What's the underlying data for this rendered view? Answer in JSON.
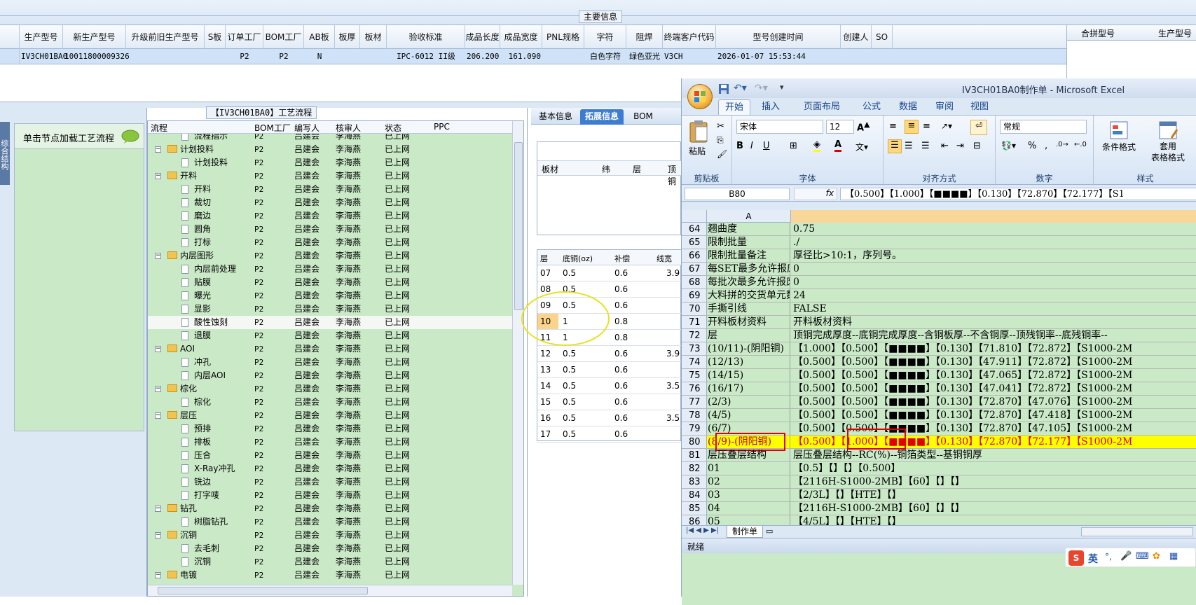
{
  "top": {
    "section_title": "主要信息"
  },
  "main_table": {
    "headers": [
      "生产型号",
      "新生产型号",
      "升级前旧生产型号",
      "S板",
      "订单工厂",
      "BOM工厂",
      "AB板",
      "板厚",
      "板材",
      "验收标准",
      "成品长度",
      "成品宽度",
      "PNL规格",
      "字符",
      "阻焊",
      "终端客户代码",
      "型号创建时间",
      "创建人",
      "SO"
    ],
    "row": [
      "IV3CH01BA0",
      "10011800009326",
      "",
      "",
      "P2",
      "P2",
      "N",
      "",
      "",
      "IPC-6012 II级",
      "206.200",
      "161.090",
      "",
      "白色字符",
      "绿色亚光",
      "V3CH",
      "2026-01-07 15:53:44",
      "",
      ""
    ],
    "right_headers": [
      "合拼型号",
      "生产型号"
    ]
  },
  "left_panel": {
    "side_tab": "综合结构",
    "hint": "单击节点加载工艺流程"
  },
  "process": {
    "title": "【IV3CH01BA0】工艺流程",
    "headers": [
      "流程",
      "BOM工厂",
      "编写人",
      "核审人",
      "状态",
      "PPC"
    ],
    "rows": [
      {
        "name": "流程指示",
        "factory": "P2",
        "writer": "吕建会",
        "reviewer": "李海燕",
        "status": "已上网",
        "level": 2
      },
      {
        "name": "计划投料",
        "factory": "P2",
        "writer": "吕建会",
        "reviewer": "李海燕",
        "status": "已上网",
        "level": 1
      },
      {
        "name": "计划投料",
        "factory": "P2",
        "writer": "吕建会",
        "reviewer": "李海燕",
        "status": "已上网",
        "level": 2
      },
      {
        "name": "开料",
        "factory": "P2",
        "writer": "吕建会",
        "reviewer": "李海燕",
        "status": "已上网",
        "level": 1
      },
      {
        "name": "开料",
        "factory": "P2",
        "writer": "吕建会",
        "reviewer": "李海燕",
        "status": "已上网",
        "level": 2
      },
      {
        "name": "裁切",
        "factory": "P2",
        "writer": "吕建会",
        "reviewer": "李海燕",
        "status": "已上网",
        "level": 2
      },
      {
        "name": "磨边",
        "factory": "P2",
        "writer": "吕建会",
        "reviewer": "李海燕",
        "status": "已上网",
        "level": 2
      },
      {
        "name": "圆角",
        "factory": "P2",
        "writer": "吕建会",
        "reviewer": "李海燕",
        "status": "已上网",
        "level": 2
      },
      {
        "name": "打标",
        "factory": "P2",
        "writer": "吕建会",
        "reviewer": "李海燕",
        "status": "已上网",
        "level": 2
      },
      {
        "name": "内层图形",
        "factory": "P2",
        "writer": "吕建会",
        "reviewer": "李海燕",
        "status": "已上网",
        "level": 1
      },
      {
        "name": "内层前处理",
        "factory": "P2",
        "writer": "吕建会",
        "reviewer": "李海燕",
        "status": "已上网",
        "level": 2
      },
      {
        "name": "贴膜",
        "factory": "P2",
        "writer": "吕建会",
        "reviewer": "李海燕",
        "status": "已上网",
        "level": 2
      },
      {
        "name": "曝光",
        "factory": "P2",
        "writer": "吕建会",
        "reviewer": "李海燕",
        "status": "已上网",
        "level": 2
      },
      {
        "name": "显影",
        "factory": "P2",
        "writer": "吕建会",
        "reviewer": "李海燕",
        "status": "已上网",
        "level": 2
      },
      {
        "name": "酸性蚀刻",
        "factory": "P2",
        "writer": "吕建会",
        "reviewer": "李海燕",
        "status": "已上网",
        "level": 2,
        "selected": true
      },
      {
        "name": "退膜",
        "factory": "P2",
        "writer": "吕建会",
        "reviewer": "李海燕",
        "status": "已上网",
        "level": 2
      },
      {
        "name": "AOI",
        "factory": "P2",
        "writer": "吕建会",
        "reviewer": "李海燕",
        "status": "已上网",
        "level": 1
      },
      {
        "name": "冲孔",
        "factory": "P2",
        "writer": "吕建会",
        "reviewer": "李海燕",
        "status": "已上网",
        "level": 2
      },
      {
        "name": "内层AOI",
        "factory": "P2",
        "writer": "吕建会",
        "reviewer": "李海燕",
        "status": "已上网",
        "level": 2
      },
      {
        "name": "棕化",
        "factory": "P2",
        "writer": "吕建会",
        "reviewer": "李海燕",
        "status": "已上网",
        "level": 1
      },
      {
        "name": "棕化",
        "factory": "P2",
        "writer": "吕建会",
        "reviewer": "李海燕",
        "status": "已上网",
        "level": 2
      },
      {
        "name": "层压",
        "factory": "P2",
        "writer": "吕建会",
        "reviewer": "李海燕",
        "status": "已上网",
        "level": 1
      },
      {
        "name": "预排",
        "factory": "P2",
        "writer": "吕建会",
        "reviewer": "李海燕",
        "status": "已上网",
        "level": 2
      },
      {
        "name": "排板",
        "factory": "P2",
        "writer": "吕建会",
        "reviewer": "李海燕",
        "status": "已上网",
        "level": 2
      },
      {
        "name": "压合",
        "factory": "P2",
        "writer": "吕建会",
        "reviewer": "李海燕",
        "status": "已上网",
        "level": 2
      },
      {
        "name": "X-Ray冲孔",
        "factory": "P2",
        "writer": "吕建会",
        "reviewer": "李海燕",
        "status": "已上网",
        "level": 2
      },
      {
        "name": "铣边",
        "factory": "P2",
        "writer": "吕建会",
        "reviewer": "李海燕",
        "status": "已上网",
        "level": 2
      },
      {
        "name": "打字唛",
        "factory": "P2",
        "writer": "吕建会",
        "reviewer": "李海燕",
        "status": "已上网",
        "level": 2
      },
      {
        "name": "钻孔",
        "factory": "P2",
        "writer": "吕建会",
        "reviewer": "李海燕",
        "status": "已上网",
        "level": 1
      },
      {
        "name": "树脂钻孔",
        "factory": "P2",
        "writer": "吕建会",
        "reviewer": "李海燕",
        "status": "已上网",
        "level": 2
      },
      {
        "name": "沉铜",
        "factory": "P2",
        "writer": "吕建会",
        "reviewer": "李海燕",
        "status": "已上网",
        "level": 1
      },
      {
        "name": "去毛刺",
        "factory": "P2",
        "writer": "吕建会",
        "reviewer": "李海燕",
        "status": "已上网",
        "level": 2
      },
      {
        "name": "沉铜",
        "factory": "P2",
        "writer": "吕建会",
        "reviewer": "李海燕",
        "status": "已上网",
        "level": 2
      },
      {
        "name": "电镀",
        "factory": "P2",
        "writer": "吕建会",
        "reviewer": "李海燕",
        "status": "已上网",
        "level": 1
      }
    ]
  },
  "mid": {
    "tabs": [
      "基本信息",
      "拓展信息",
      "BOM"
    ],
    "active_tab": "拓展信息",
    "top_headers": [
      "板材",
      "纬",
      "层",
      "顶铜"
    ],
    "layer_headers": [
      "层",
      "底铜(oz)",
      "补偿",
      "线宽"
    ],
    "layer_rows": [
      {
        "layer": "07",
        "base": "0.5",
        "comp": "0.6",
        "w": "3.9"
      },
      {
        "layer": "08",
        "base": "0.5",
        "comp": "0.6",
        "w": ""
      },
      {
        "layer": "09",
        "base": "0.5",
        "comp": "0.6",
        "w": ""
      },
      {
        "layer": "10",
        "base": "1",
        "comp": "0.8",
        "w": ""
      },
      {
        "layer": "11",
        "base": "1",
        "comp": "0.8",
        "w": ""
      },
      {
        "layer": "12",
        "base": "0.5",
        "comp": "0.6",
        "w": "3.9"
      },
      {
        "layer": "13",
        "base": "0.5",
        "comp": "0.6",
        "w": ""
      },
      {
        "layer": "14",
        "base": "0.5",
        "comp": "0.6",
        "w": "3.5"
      },
      {
        "layer": "15",
        "base": "0.5",
        "comp": "0.6",
        "w": ""
      },
      {
        "layer": "16",
        "base": "0.5",
        "comp": "0.6",
        "w": "3.5"
      },
      {
        "layer": "17",
        "base": "0.5",
        "comp": "0.6",
        "w": ""
      }
    ]
  },
  "excel": {
    "title": "IV3CH01BA0制作单 - Microsoft Excel",
    "tabs": [
      "开始",
      "插入",
      "页面布局",
      "公式",
      "数据",
      "审阅",
      "视图"
    ],
    "font_name": "宋体",
    "font_size": "12",
    "number_format": "常规",
    "groups": [
      "剪贴板",
      "字体",
      "对齐方式",
      "数字",
      "样式"
    ],
    "paste_label": "粘贴",
    "cond_format_label": "条件格式",
    "table_format_label": "套用\n表格格式",
    "name_box": "B80",
    "formula": "【0.500】【1.000】【■■■■】【0.130】【72.870】【72.177】【S1",
    "col_a": "A",
    "rows": [
      {
        "n": "64",
        "a": "翘曲度",
        "b": "0.75"
      },
      {
        "n": "65",
        "a": "限制批量",
        "b": "./"
      },
      {
        "n": "66",
        "a": "限制批量备注",
        "b": "厚径比>10:1，序列号。"
      },
      {
        "n": "67",
        "a": "每SET最多允许报废单",
        "b": "0"
      },
      {
        "n": "68",
        "a": "每批次最多允许报废",
        "b": "0"
      },
      {
        "n": "69",
        "a": "大料拼的交货单元数",
        "b": "24"
      },
      {
        "n": "70",
        "a": "手撕引线",
        "b": "FALSE"
      },
      {
        "n": "71",
        "a": "开料板材资料",
        "b": "开料板材资料"
      },
      {
        "n": "72",
        "a": "层",
        "b": "顶铜完成厚度--底铜完成厚度--含铜板厚--不含铜厚--顶残铜率--底残铜率--"
      },
      {
        "n": "73",
        "a": "(10/11)-(阴阳铜)",
        "b": "【1.000】【0.500】【■■■■】【0.130】【71.810】【72.872】【S1000-2M"
      },
      {
        "n": "74",
        "a": "(12/13)",
        "b": "【0.500】【0.500】【■■■■】【0.130】【47.911】【72.872】【S1000-2M"
      },
      {
        "n": "75",
        "a": "(14/15)",
        "b": "【0.500】【0.500】【■■■■】【0.130】【47.065】【72.872】【S1000-2M"
      },
      {
        "n": "76",
        "a": "(16/17)",
        "b": "【0.500】【0.500】【■■■■】【0.130】【47.041】【72.872】【S1000-2M"
      },
      {
        "n": "77",
        "a": "(2/3)",
        "b": "【0.500】【0.500】【■■■■】【0.130】【72.870】【47.076】【S1000-2M"
      },
      {
        "n": "78",
        "a": "(4/5)",
        "b": "【0.500】【0.500】【■■■■】【0.130】【72.870】【47.418】【S1000-2M"
      },
      {
        "n": "79",
        "a": "(6/7)",
        "b": "【0.500】【0.500】【■■■■】【0.130】【72.870】【47.105】【S1000-2M"
      },
      {
        "n": "80",
        "a": "(8/9)-(阴阳铜)",
        "b": "【0.500】【1.000】【■■■■】【0.130】【72.870】【72.177】【S1000-2M",
        "hl": true
      },
      {
        "n": "81",
        "a": "层压叠层结构",
        "b": "层压叠层结构--RC(%)--铜箔类型--基铜铜厚"
      },
      {
        "n": "82",
        "a": "01",
        "b": "【0.5】【】【】【0.500】"
      },
      {
        "n": "83",
        "a": "02",
        "b": "【2116H-S1000-2MB】【60】【】【】"
      },
      {
        "n": "84",
        "a": "03",
        "b": "【2/3L】【】【HTE】【】"
      },
      {
        "n": "85",
        "a": "04",
        "b": "【2116H-S1000-2MB】【60】【】【】"
      },
      {
        "n": "86",
        "a": "05",
        "b": "【4/5L】【】【HTE】【】"
      }
    ],
    "sheet_tab": "制作单",
    "status": "就绪",
    "ime": "英"
  }
}
